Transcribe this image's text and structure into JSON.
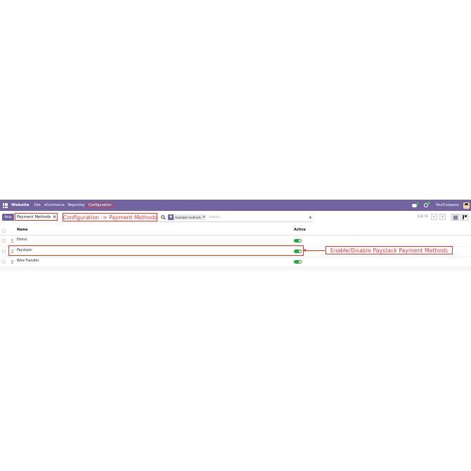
{
  "navbar": {
    "brand": "Website",
    "menu": [
      "Site",
      "eCommerce",
      "Reporting",
      "Configuration"
    ],
    "messages_badge": "7",
    "activity_badge": "3",
    "company": "YourCompany",
    "color": "#71639e"
  },
  "control": {
    "new_label": "New",
    "breadcrumb": "Payment Methods",
    "gear_icon": "gear-icon",
    "facet": "Available methods",
    "search_placeholder": "Search...",
    "pager": "1-3 / 3"
  },
  "annotations": {
    "configuration": "Configuration -> Payment Methods",
    "toggle": "Enable/Disable Paystack Payment Methods",
    "color": "#e53935"
  },
  "table": {
    "headers": {
      "name": "Name",
      "active": "Active"
    },
    "rows": [
      {
        "name": "Demo",
        "active": true
      },
      {
        "name": "Paystack",
        "active": true
      },
      {
        "name": "Wire Transfer",
        "active": true
      }
    ]
  }
}
